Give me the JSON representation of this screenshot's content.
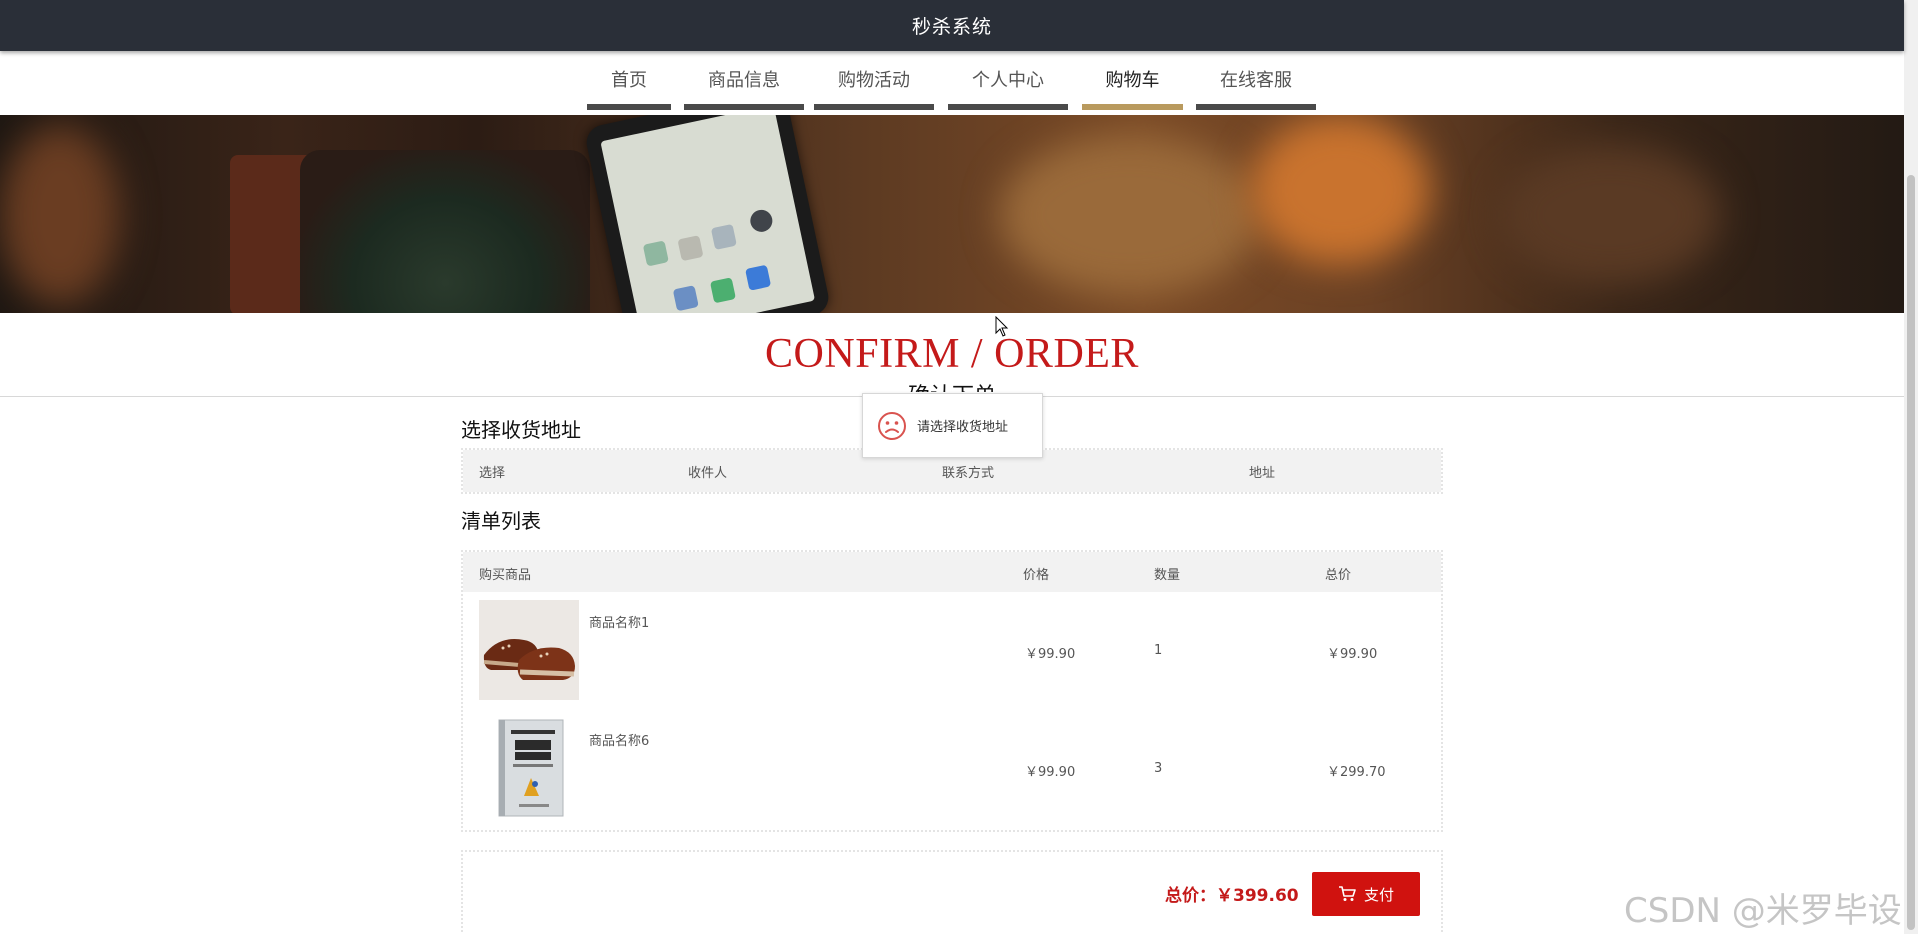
{
  "app": {
    "title": "秒杀系统"
  },
  "nav": {
    "items": [
      {
        "label": "首页",
        "active": false
      },
      {
        "label": "商品信息",
        "active": false
      },
      {
        "label": "购物活动",
        "active": false
      },
      {
        "label": "个人中心",
        "active": false
      },
      {
        "label": "购物车",
        "active": true
      },
      {
        "label": "在线客服",
        "active": false
      }
    ]
  },
  "heading": {
    "en": "CONFIRM / ORDER",
    "zh": "确认下单"
  },
  "toast": {
    "message": "请选择收货地址",
    "icon": "sad-face-icon"
  },
  "address": {
    "title": "选择收货地址",
    "columns": [
      "选择",
      "收件人",
      "联系方式",
      "地址"
    ]
  },
  "list": {
    "title": "清单列表",
    "columns": [
      "购买商品",
      "价格",
      "数量",
      "总价"
    ],
    "rows": [
      {
        "name": "商品名称1",
        "price": "￥99.90",
        "qty": "1",
        "total": "￥99.90",
        "image": "brown-shoes"
      },
      {
        "name": "商品名称6",
        "price": "￥99.90",
        "qty": "3",
        "total": "￥299.70",
        "image": "book"
      }
    ]
  },
  "summary": {
    "total_label": "总价：￥399.60",
    "pay_label": "支付",
    "pay_icon": "cart-icon"
  },
  "watermark": "CSDN @米罗毕设",
  "colors": {
    "accent": "#c41a1a",
    "pay": "#d0120f",
    "topbar": "#2a2f38",
    "nav_active": "#b99a5e",
    "nav_bar": "#4a4a4a"
  }
}
